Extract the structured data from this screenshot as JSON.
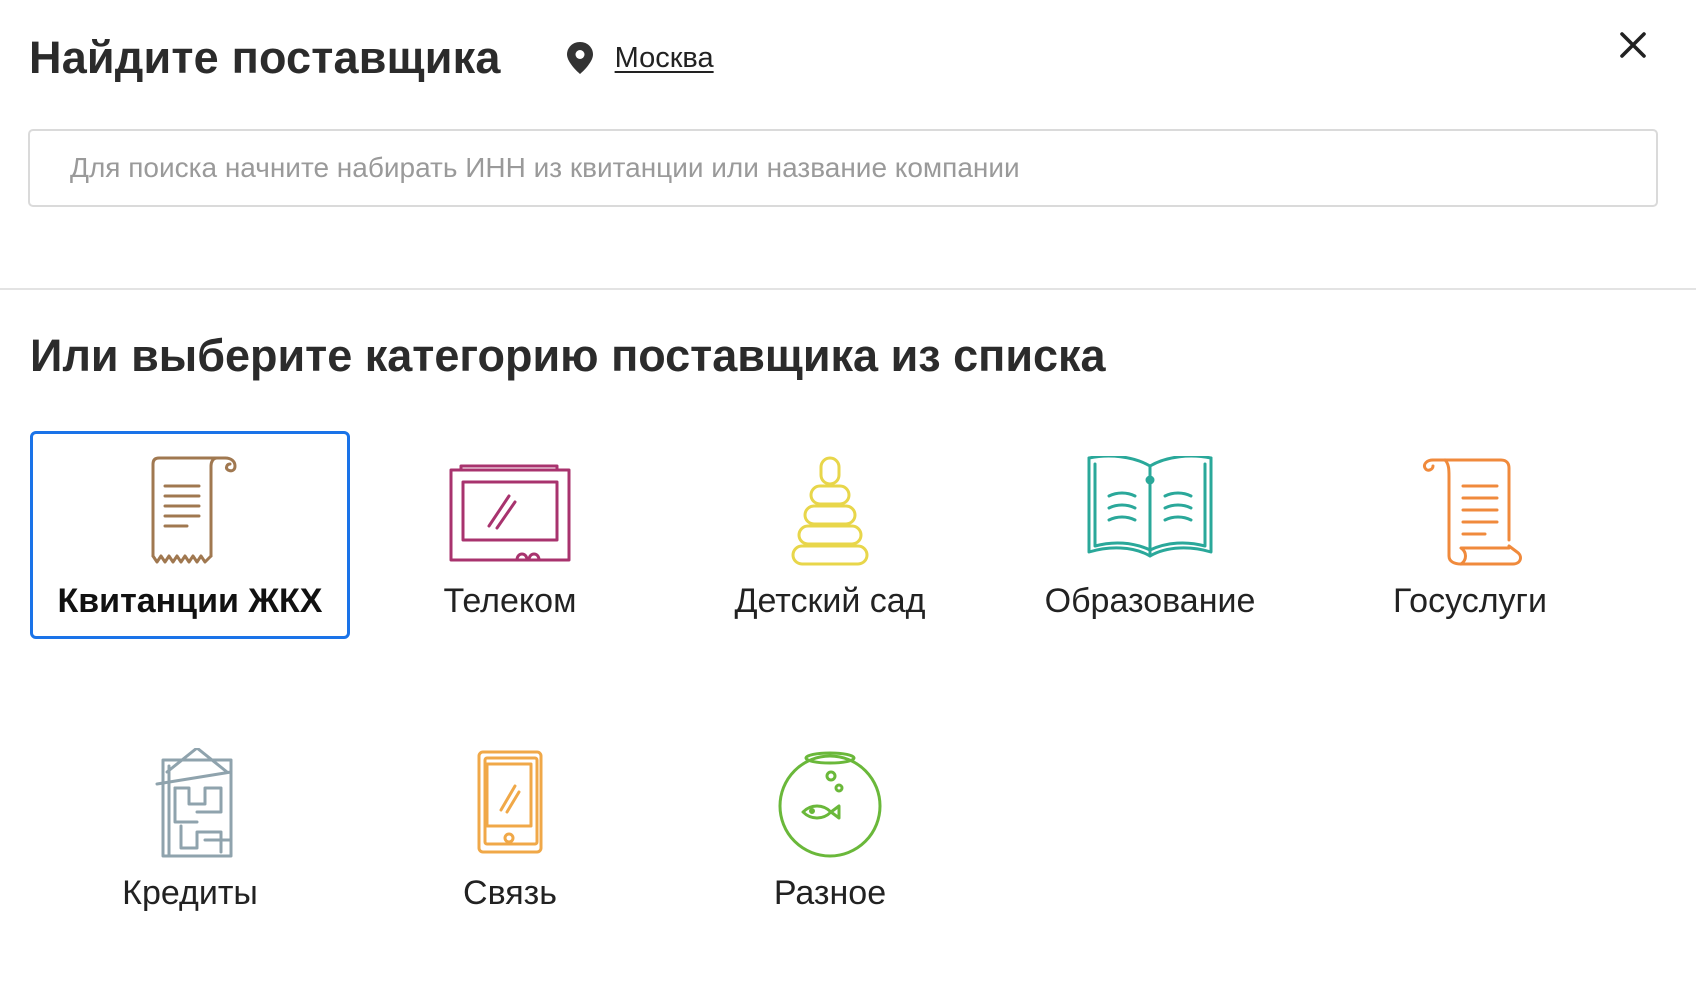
{
  "header": {
    "title": "Найдите поставщика",
    "city": "Москва"
  },
  "search": {
    "placeholder": "Для поиска начните набирать ИНН из квитанции или название компании",
    "value": ""
  },
  "section_title": "Или выберите категорию поставщика из списка",
  "categories": [
    {
      "label": "Квитанции ЖКХ",
      "icon": "receipt-icon",
      "color": "#a07850",
      "selected": true
    },
    {
      "label": "Телеком",
      "icon": "tv-icon",
      "color": "#a8336e",
      "selected": false
    },
    {
      "label": "Детский сад",
      "icon": "pyramid-toy-icon",
      "color": "#e8d64a",
      "selected": false
    },
    {
      "label": "Образование",
      "icon": "open-book-icon",
      "color": "#2aa89a",
      "selected": false
    },
    {
      "label": "Госуслуги",
      "icon": "scroll-icon",
      "color": "#f08a3c",
      "selected": false
    },
    {
      "label": "Кредиты",
      "icon": "building-icon",
      "color": "#8fa3ad",
      "selected": false
    },
    {
      "label": "Связь",
      "icon": "tablet-icon",
      "color": "#f0a848",
      "selected": false
    },
    {
      "label": "Разное",
      "icon": "fishbowl-icon",
      "color": "#6ab83a",
      "selected": false
    }
  ],
  "colors": {
    "selected_border": "#1a73e8",
    "divider": "#e3e3e3",
    "input_border": "#dadada"
  }
}
